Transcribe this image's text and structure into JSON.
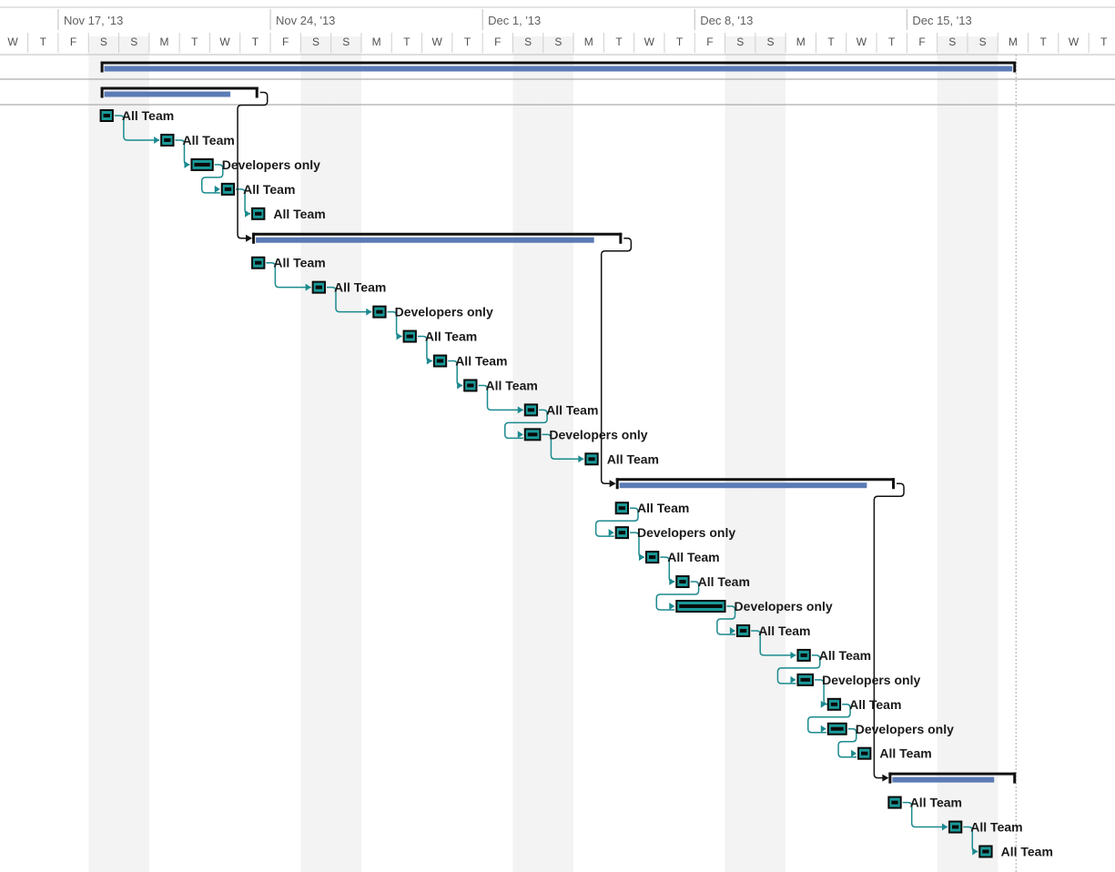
{
  "colors": {
    "task_fill": "#1a9a9a",
    "task_border": "#0a0a0a",
    "summary_fill": "#5b7bb5",
    "summary_bracket": "#111111",
    "link_teal": "#1b8a8f",
    "link_black": "#111111",
    "weekend_shade": "#f3f3f3",
    "grid_line": "#9a9a9a"
  },
  "chart_data": {
    "type": "gantt",
    "timescale": {
      "weeks": [
        {
          "label": "Nov 17, '13",
          "day": 2
        },
        {
          "label": "Nov 24, '13",
          "day": 9
        },
        {
          "label": "Dec 1, '13",
          "day": 16
        },
        {
          "label": "Dec 8, '13",
          "day": 23
        },
        {
          "label": "Dec 15, '13",
          "day": 30
        }
      ],
      "days": [
        "W",
        "T",
        "F",
        "S",
        "S",
        "M",
        "T",
        "W",
        "T",
        "F",
        "S",
        "S",
        "M",
        "T",
        "W",
        "T",
        "F",
        "S",
        "S",
        "M",
        "T",
        "W",
        "T",
        "F",
        "S",
        "S",
        "M",
        "T",
        "W",
        "T",
        "F",
        "S",
        "S",
        "M",
        "T",
        "W",
        "T"
      ]
    },
    "project_summary": {
      "start": 2.9,
      "end": 33.1,
      "progress_end": 33.1
    },
    "phase_summaries": [
      {
        "start": 2.9,
        "end": 8.1,
        "progress_end": 7.3
      },
      {
        "start": 7.9,
        "end": 20.1,
        "progress_end": 19.3
      },
      {
        "start": 19.9,
        "end": 29.1,
        "progress_end": 28.3
      },
      {
        "start": 28.9,
        "end": 33.1,
        "progress_end": 32.5
      }
    ],
    "tasks": [
      {
        "start": 2.9,
        "end": 3.3,
        "label": "All Team"
      },
      {
        "start": 4.9,
        "end": 5.3,
        "label": "All Team"
      },
      {
        "start": 5.9,
        "end": 6.6,
        "label": "Developers only"
      },
      {
        "start": 6.9,
        "end": 7.3,
        "label": "All Team"
      },
      {
        "start": 7.9,
        "end": 8.3,
        "label": "All Team"
      },
      {
        "start": 7.9,
        "end": 8.3,
        "label": "All Team"
      },
      {
        "start": 9.9,
        "end": 10.3,
        "label": "All Team"
      },
      {
        "start": 11.9,
        "end": 12.3,
        "label": "Developers only"
      },
      {
        "start": 12.9,
        "end": 13.3,
        "label": "All Team"
      },
      {
        "start": 13.9,
        "end": 14.3,
        "label": "All Team"
      },
      {
        "start": 14.9,
        "end": 15.3,
        "label": "All Team"
      },
      {
        "start": 16.9,
        "end": 17.3,
        "label": "All Team"
      },
      {
        "start": 16.9,
        "end": 17.4,
        "label": "Developers only"
      },
      {
        "start": 18.9,
        "end": 19.3,
        "label": "All Team"
      },
      {
        "start": 19.9,
        "end": 20.3,
        "label": "All Team"
      },
      {
        "start": 19.9,
        "end": 20.3,
        "label": "Developers only"
      },
      {
        "start": 20.9,
        "end": 21.3,
        "label": "All Team"
      },
      {
        "start": 21.9,
        "end": 22.3,
        "label": "All Team"
      },
      {
        "start": 21.9,
        "end": 23.5,
        "label": "Developers only"
      },
      {
        "start": 23.9,
        "end": 24.3,
        "label": "All Team"
      },
      {
        "start": 25.9,
        "end": 26.3,
        "label": "All Team"
      },
      {
        "start": 25.9,
        "end": 26.4,
        "label": "Developers only"
      },
      {
        "start": 26.9,
        "end": 27.3,
        "label": "All Team"
      },
      {
        "start": 26.9,
        "end": 27.5,
        "label": "Developers only"
      },
      {
        "start": 27.9,
        "end": 28.3,
        "label": "All Team"
      },
      {
        "start": 28.9,
        "end": 29.3,
        "label": "All Team"
      },
      {
        "start": 30.9,
        "end": 31.3,
        "label": "All Team"
      },
      {
        "start": 31.9,
        "end": 32.3,
        "label": "All Team"
      }
    ],
    "status_date": 33.1,
    "grid": true
  }
}
